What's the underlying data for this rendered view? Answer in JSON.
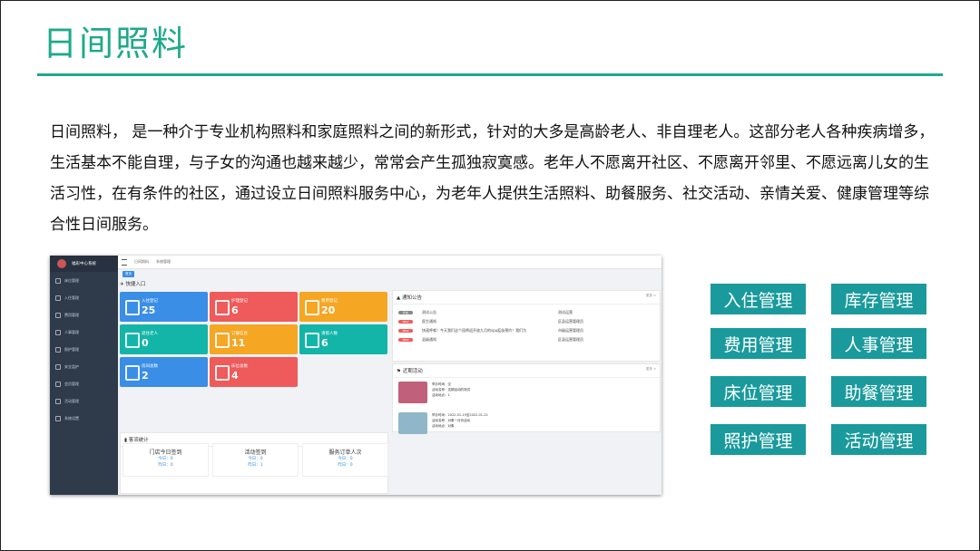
{
  "slide": {
    "title": "日间照料",
    "paragraph": "日间照料， 是一种介于专业机构照料和家庭照料之间的新形式，针对的大多是高龄老人、非自理老人。这部分老人各种疾病增多，生活基本不能自理，与子女的沟通也越来越少，常常会产生孤独寂寞感。老年人不愿离开社区、不愿离开邻里、不愿远离儿女的生活习性，在有条件的社区，通过设立日间照料服务中心，为老年人提供生活照料、助餐服务、社交活动、亲情关爱、健康管理等综合性日间服务。"
  },
  "app": {
    "system_name": "福彩中心系统",
    "sidebar": [
      "床位管理",
      "入住管理",
      "费用管理",
      "人事管理",
      "照护管理",
      "安全监护",
      "会员管理",
      "活动管理",
      "系统设置"
    ],
    "top_tabs": [
      "日间照料",
      "系统管理"
    ],
    "tab_chip": "首页",
    "quick_entry_title": "快捷入口",
    "tiles": [
      {
        "label": "入住登记",
        "value": "25",
        "color": "#3a8ee6"
      },
      {
        "label": "护理登记",
        "value": "6",
        "color": "#ef5a5a"
      },
      {
        "label": "费用登记",
        "value": "20",
        "color": "#f5a623"
      },
      {
        "label": "退住老人",
        "value": "0",
        "color": "#13b5a9"
      },
      {
        "label": "订餐信息",
        "value": "11",
        "color": "#f5a623"
      },
      {
        "label": "请假人数",
        "value": "6",
        "color": "#13b5a9"
      },
      {
        "label": "房间总数",
        "value": "2",
        "color": "#3a8ee6"
      },
      {
        "label": "床位总数",
        "value": "4",
        "color": "#ef5a5a"
      }
    ],
    "notice": {
      "title": "通知公告",
      "more": "更多 >",
      "rows": [
        {
          "badge": "状态",
          "c1": "测试公告",
          "c2": "测试运营",
          "badge_color": "#888"
        },
        {
          "badge": "NEW",
          "c1": "医生通知",
          "c2": "区县运营管理员",
          "badge_color": "#ef5a5a"
        },
        {
          "badge": "NEW",
          "c1": "快速呼唤！今天我们这个园将迎开放九月的spu疫苗预约！我们为",
          "c2": "市级运营管理员",
          "badge_color": "#ef5a5a"
        },
        {
          "badge": "NEW",
          "c1": "县级通知",
          "c2": "区县运营管理员",
          "badge_color": "#ef5a5a"
        }
      ]
    },
    "activity": {
      "title": "近期活动",
      "more": "更多 >",
      "items": [
        {
          "line1": "举办时间：空",
          "line2": "活动名称：这期活动的测试",
          "line3": "活动地点：1",
          "img": "#c0607a"
        },
        {
          "line1": "举办时间：2022-01-19至2022-01-22",
          "line2": "活动名称：对象一月份活动",
          "line3": "活动地点：对象",
          "img": "#8fb7c9"
        }
      ]
    },
    "stats": {
      "title": "客流统计",
      "boxes": [
        {
          "label": "门店今日签到",
          "today": "今日：0",
          "yesterday": "昨日：0"
        },
        {
          "label": "活动签到",
          "today": "今日：0",
          "yesterday": "昨日：1"
        },
        {
          "label": "服务订单人次",
          "today": "今日：0",
          "yesterday": "昨日：0"
        }
      ]
    }
  },
  "modules": [
    "入住管理",
    "库存管理",
    "费用管理",
    "人事管理",
    "床位管理",
    "助餐管理",
    "照护管理",
    "活动管理"
  ]
}
